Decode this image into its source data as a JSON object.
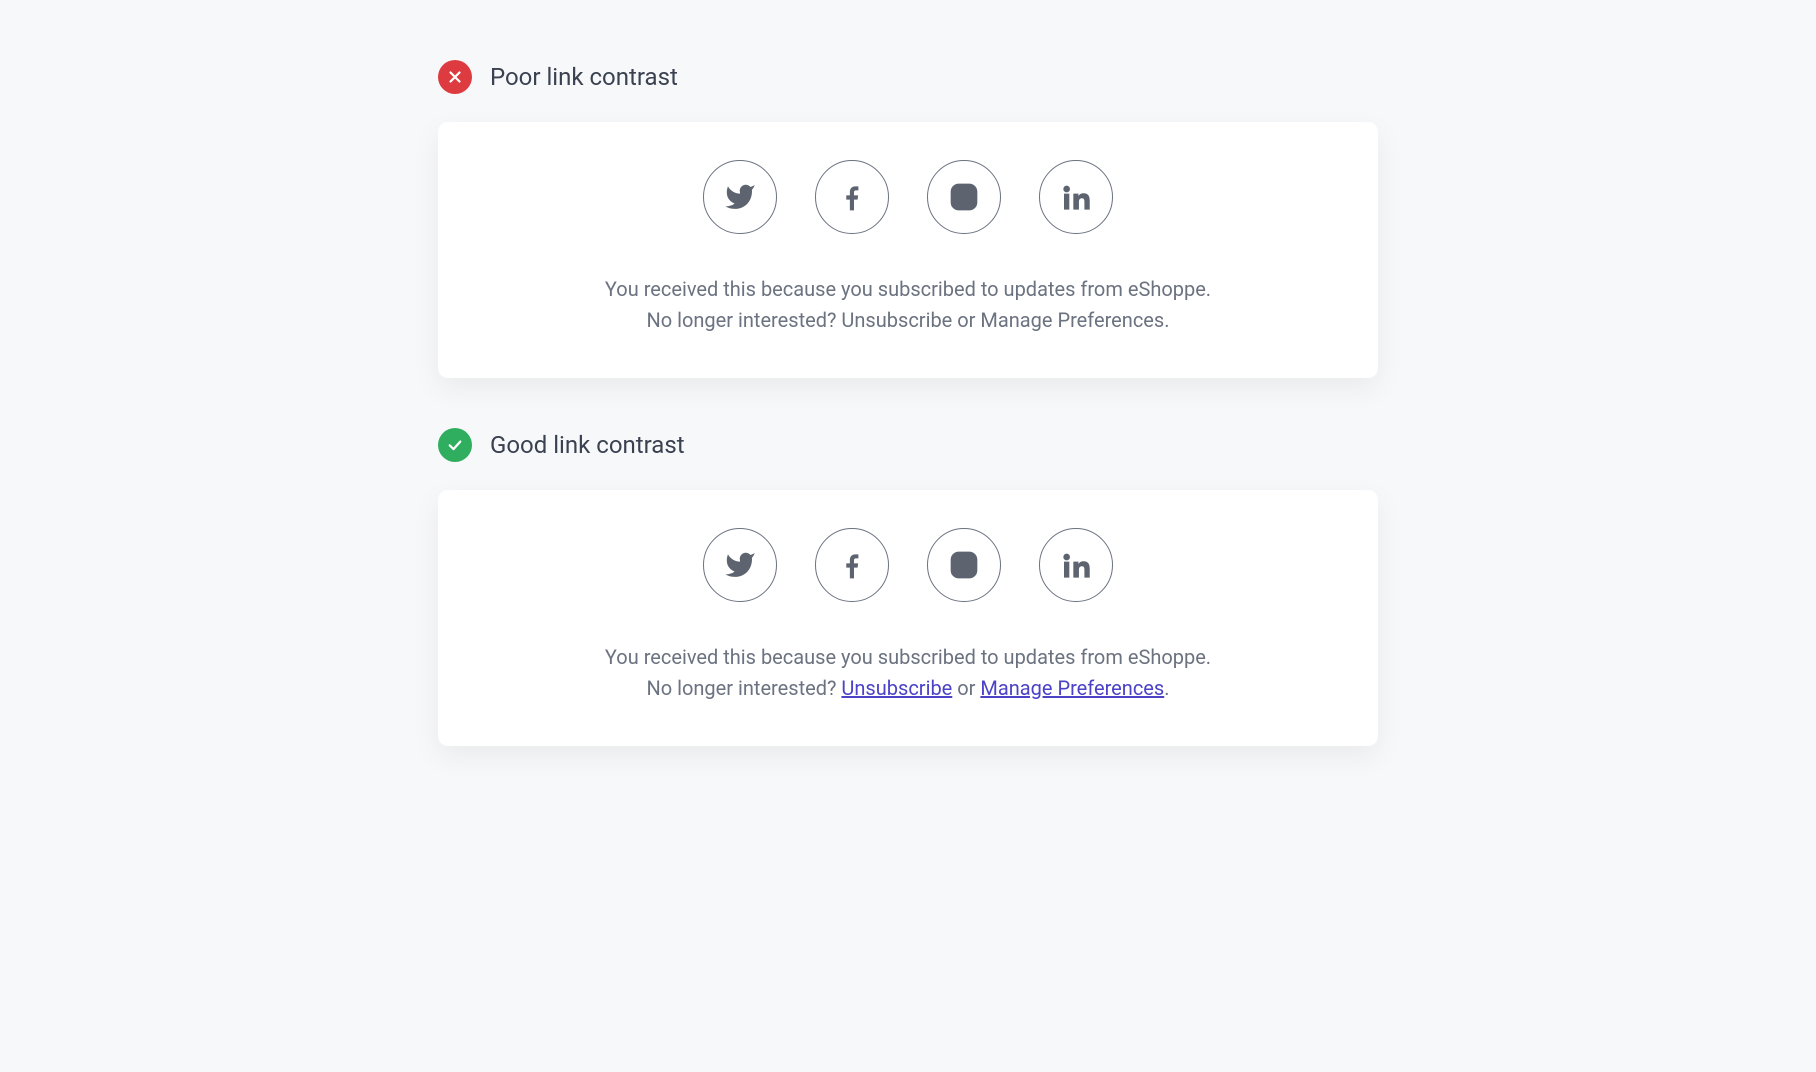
{
  "examples": {
    "poor": {
      "label": "Poor link contrast",
      "footer_line1": "You received this because you subscribed to updates from eShoppe.",
      "footer_prefix": "No longer interested? ",
      "unsubscribe": "Unsubscribe",
      "or": " or ",
      "manage": "Manage Preferences",
      "period": "."
    },
    "good": {
      "label": "Good link contrast",
      "footer_line1": "You received this because you subscribed to updates from eShoppe.",
      "footer_prefix": "No longer interested? ",
      "unsubscribe": "Unsubscribe",
      "or": " or ",
      "manage": "Manage Preferences",
      "period": "."
    }
  }
}
